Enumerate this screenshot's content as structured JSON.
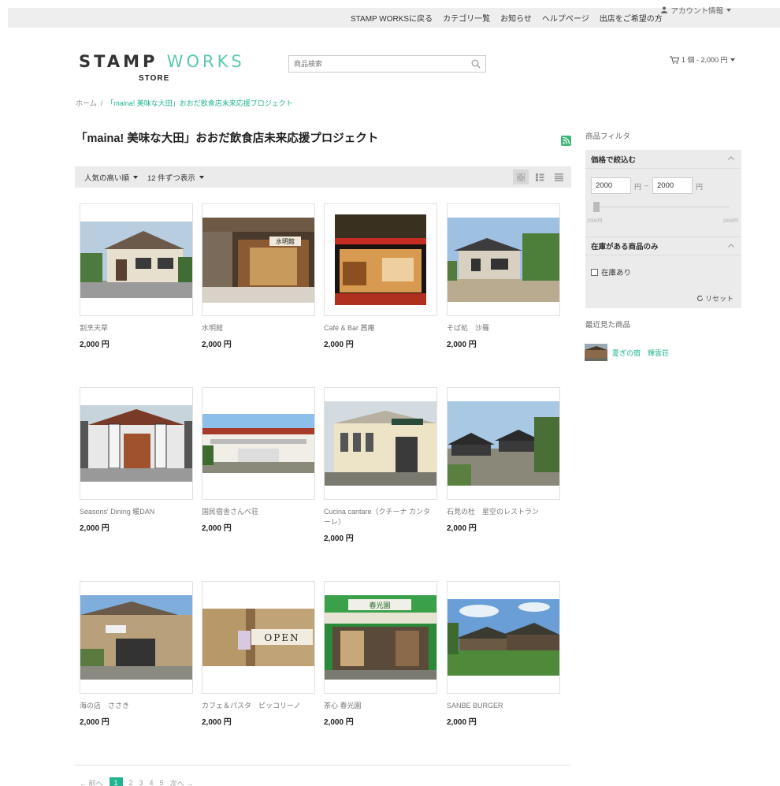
{
  "topbar": {
    "links": [
      "STAMP WORKSに戻る",
      "カテゴリ一覧",
      "お知らせ",
      "ヘルプページ",
      "出店をご希望の方"
    ],
    "account": "アカウント情報"
  },
  "logo": {
    "main_pre": "STAMP",
    "main_w": "WO",
    "main_post": "RKS",
    "sub": "STORE"
  },
  "search": {
    "placeholder": "商品検索"
  },
  "cart": {
    "summary": "1 個 - 2,000 円"
  },
  "breadcrumb": {
    "home": "ホーム",
    "separator": "/",
    "current": "「maina! 美味な大田」おおだ飲食店未来応援プロジェクト"
  },
  "page_title": "「maina! 美味な大田」おおだ飲食店未来応援プロジェクト",
  "sortbar": {
    "sort_label": "人気の高い順",
    "per_page_label": "12 件ずつ表示"
  },
  "products": [
    {
      "name": "割烹天草",
      "price": "2,000 円"
    },
    {
      "name": "水明館",
      "price": "2,000 円"
    },
    {
      "name": "Café & Bar 茜庵",
      "price": "2,000 円"
    },
    {
      "name": "そば処　沙羅",
      "price": "2,000 円"
    },
    {
      "name": "Seasons' Dining 暖DAN",
      "price": "2,000 円"
    },
    {
      "name": "国民宿舎さんべ荘",
      "price": "2,000 円"
    },
    {
      "name": "Cucina cantare（クチーナ カンターレ）",
      "price": "2,000 円"
    },
    {
      "name": "石見の杜　星空のレストラン",
      "price": "2,000 円"
    },
    {
      "name": "海の店　ささき",
      "price": "2,000 円"
    },
    {
      "name": "カフェ＆パスタ　ピッコリーノ",
      "price": "2,000 円"
    },
    {
      "name": "茶心 春光園",
      "price": "2,000 円"
    },
    {
      "name": "SANBE BURGER",
      "price": "2,000 円"
    }
  ],
  "photo_text": {
    "sign_suimeikan": "水明館",
    "sign_open": "OPEN",
    "sign_shunkoen": "春光園"
  },
  "pager": {
    "prev": "← 前へ",
    "pages": [
      "1",
      "2",
      "3",
      "4",
      "5"
    ],
    "next": "次へ →",
    "current_page": 1
  },
  "sidebar": {
    "title": "商品フィルタ",
    "price_filter": {
      "heading": "価格で絞込む",
      "min": "2000",
      "max": "2000",
      "unit": "円",
      "dash": "–",
      "slider_min_label": "2000円",
      "slider_max_label": "2000円"
    },
    "stock_filter": {
      "heading": "在庫がある商品のみ",
      "checkbox_label": "在庫あり",
      "checked": false
    },
    "reset_label": "リセット",
    "recent_title": "最近見た商品",
    "recent_items": [
      {
        "name": "夏ぎの宿　輝雲荘"
      }
    ]
  },
  "colors": {
    "accent": "#20b48f",
    "topbar_bg": "#eeeeee",
    "panel_bg": "#ebebeb"
  }
}
